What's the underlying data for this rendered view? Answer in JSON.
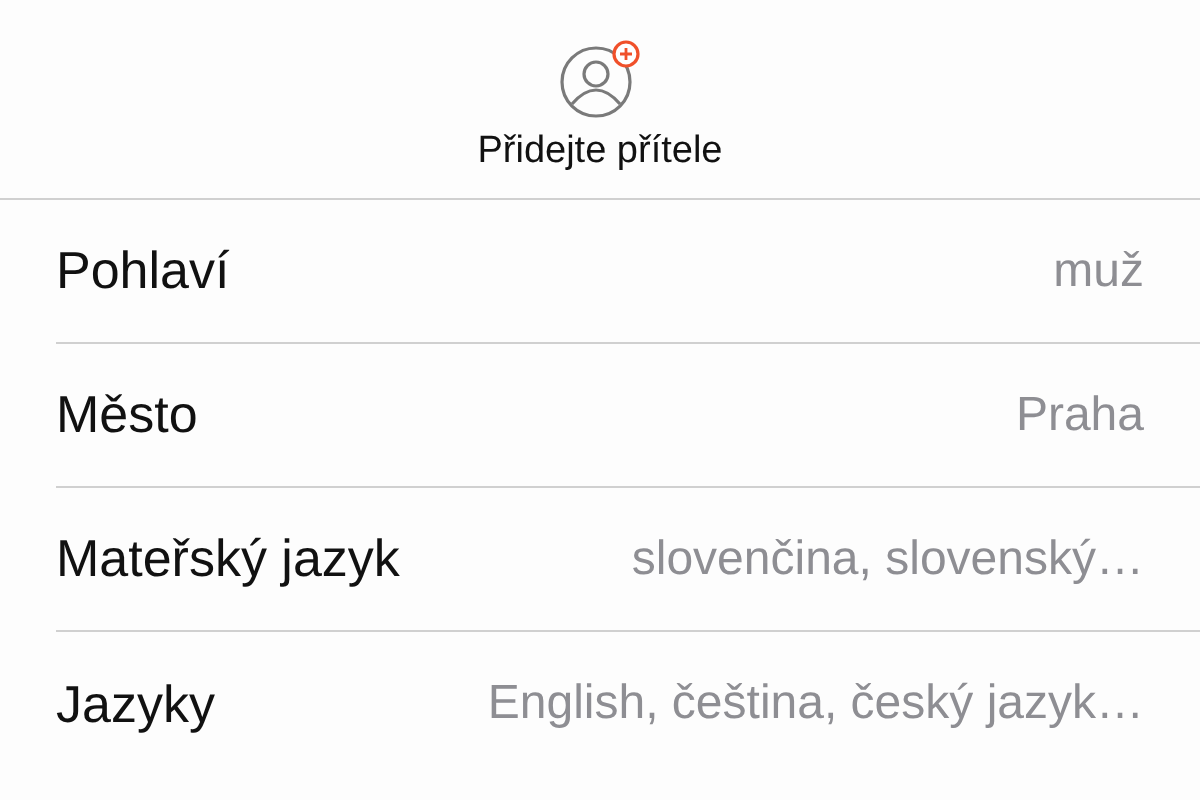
{
  "header": {
    "title": "Přidejte přítele"
  },
  "rows": [
    {
      "label": "Pohlaví",
      "value": "muž"
    },
    {
      "label": "Město",
      "value": "Praha"
    },
    {
      "label": "Mateřský jazyk",
      "value": "slovenčina, slovenský…"
    },
    {
      "label": "Jazyky",
      "value": "English, čeština, český jazyk…"
    }
  ]
}
